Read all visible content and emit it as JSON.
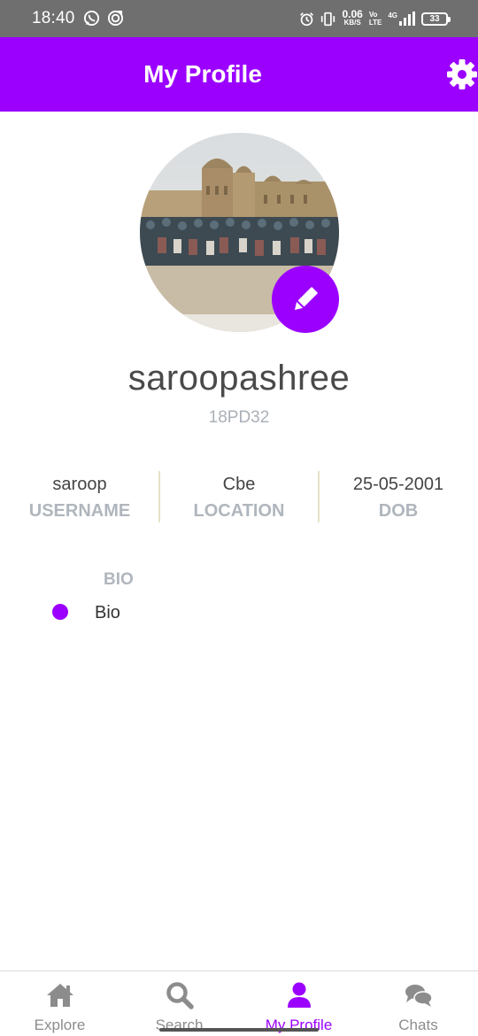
{
  "status_bar": {
    "time": "18:40",
    "network_speed": "0.06",
    "network_unit": "KB/S",
    "volte_top": "Vo",
    "volte_bottom": "LTE",
    "network_type": "4G",
    "battery": "33",
    "icons": [
      "whatsapp-icon",
      "notification-icon",
      "alarm-icon",
      "vibrate-icon",
      "signal-icon",
      "battery-icon"
    ]
  },
  "app_bar": {
    "title": "My Profile",
    "settings_icon": "gear-icon"
  },
  "profile": {
    "name": "saroopashree",
    "id": "18PD32",
    "avatar_icon": "profile-photo",
    "edit_icon": "pencil-icon"
  },
  "info": [
    {
      "value": "saroop",
      "label": "USERNAME"
    },
    {
      "value": "Cbe",
      "label": "LOCATION"
    },
    {
      "value": "25-05-2001",
      "label": "DOB"
    }
  ],
  "bio": {
    "heading": "BIO",
    "text": "Bio"
  },
  "bottom_nav": {
    "items": [
      {
        "label": "Explore",
        "icon": "home-icon",
        "active": false
      },
      {
        "label": "Search",
        "icon": "search-icon",
        "active": false
      },
      {
        "label": "My Profile",
        "icon": "user-icon",
        "active": true
      },
      {
        "label": "Chats",
        "icon": "chat-icon",
        "active": false
      }
    ]
  },
  "colors": {
    "accent": "#9b00ff",
    "status_bar": "#6f6f6f",
    "muted_label": "#b0b6bd",
    "inactive_nav": "#8c8c8c"
  }
}
